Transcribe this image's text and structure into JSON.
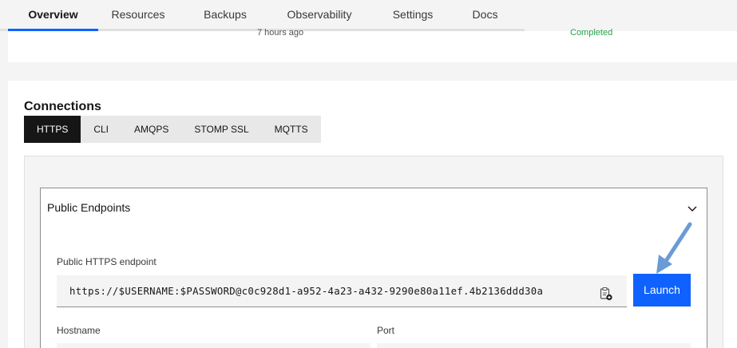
{
  "top_tabs": [
    {
      "label": "Overview"
    },
    {
      "label": "Resources"
    },
    {
      "label": "Backups"
    },
    {
      "label": "Observability"
    },
    {
      "label": "Settings"
    },
    {
      "label": "Docs"
    }
  ],
  "summary": {
    "time_text": "7 hours ago",
    "status_text": "Completed"
  },
  "connections": {
    "title": "Connections",
    "tabs": [
      "HTTPS",
      "CLI",
      "AMQPS",
      "STOMP SSL",
      "MQTTS"
    ],
    "accordion_title": "Public Endpoints",
    "endpoint_label": "Public HTTPS endpoint",
    "endpoint_value": "https://$USERNAME:$PASSWORD@c0c928d1-a952-4a23-a432-9290e80a11ef.4b2136ddd30a",
    "launch_label": "Launch",
    "hostname_label": "Hostname",
    "port_label": "Port"
  },
  "colors": {
    "accent": "#0f62fe",
    "success": "#24a148",
    "annotation_arrow": "#4a86c8"
  },
  "icons": {
    "copy": "copy-clipboard-icon",
    "chevron": "chevron-down-icon",
    "annotation": "pointer-arrow-icon"
  }
}
